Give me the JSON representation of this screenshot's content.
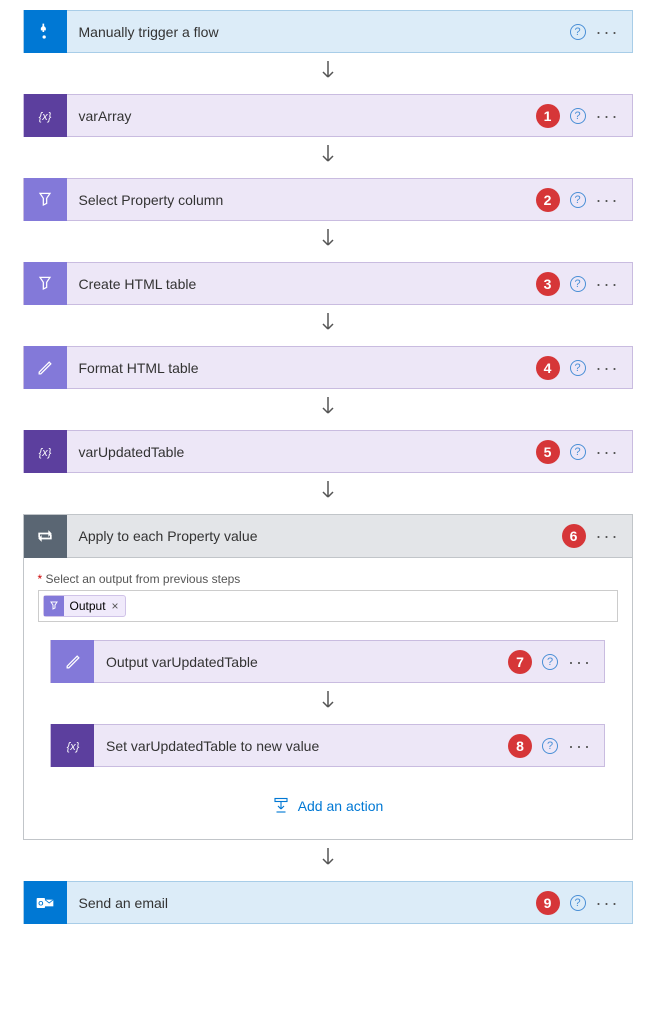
{
  "steps": {
    "trigger": {
      "label": "Manually trigger a flow"
    },
    "varArray": {
      "label": "varArray",
      "badge": "1"
    },
    "selectProp": {
      "label": "Select Property column",
      "badge": "2"
    },
    "createHtml": {
      "label": "Create HTML table",
      "badge": "3"
    },
    "formatHtml": {
      "label": "Format HTML table",
      "badge": "4"
    },
    "varUpdated": {
      "label": "varUpdatedTable",
      "badge": "5"
    },
    "applyEach": {
      "label": "Apply to each Property value",
      "badge": "6"
    },
    "outputVar": {
      "label": "Output varUpdatedTable",
      "badge": "7"
    },
    "setVar": {
      "label": "Set varUpdatedTable to new value",
      "badge": "8"
    },
    "sendEmail": {
      "label": "Send an email",
      "badge": "9"
    }
  },
  "fieldLabel": "Select an output from previous steps",
  "outputToken": "Output",
  "addAction": "Add an action",
  "helpSymbol": "?",
  "requiredSymbol": "*",
  "closeSymbol": "×"
}
